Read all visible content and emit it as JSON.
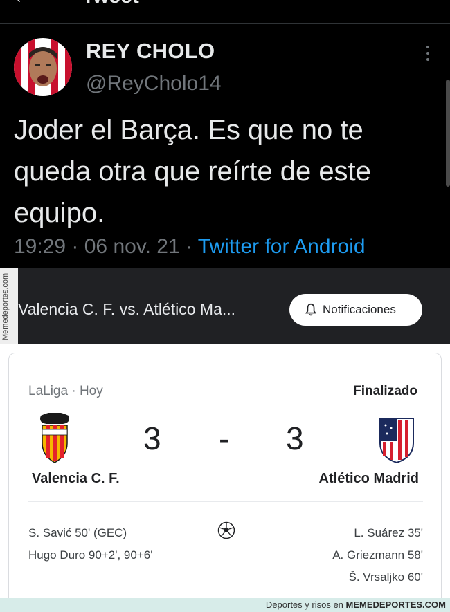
{
  "header": {
    "back_icon": "back-arrow-icon",
    "title": "Tweet"
  },
  "tweet": {
    "display_name": "REY CHOLO",
    "handle": "@ReyCholo14",
    "text": "Joder el Barça. Es que no te queda otra que reírte de este equipo.",
    "time": "19:29",
    "date": "06 nov. 21",
    "source": "Twitter for Android",
    "accent_color": "#1d9bf0"
  },
  "watermark_side": "Memedeportes.com",
  "match_header": {
    "title": "Valencia C. F. vs. Atlético Ma...",
    "notifications_label": "Notificaciones"
  },
  "match": {
    "league": "LaLiga · Hoy",
    "status": "Finalizado",
    "home_team": "Valencia C. F.",
    "away_team": "Atlético Madrid",
    "home_score": "3",
    "separator": "-",
    "away_score": "3",
    "home_goals": [
      "S. Savić 50' (GEC)",
      "Hugo Duro 90+2', 90+6'"
    ],
    "away_goals": [
      "L. Suárez 35'",
      "A. Griezmann 58'",
      "Š. Vrsaljko 60'"
    ],
    "goal_icon": "soccer-ball-icon"
  },
  "watermark_bottom": {
    "text": "Deportes y risos en",
    "brand": "MEMEDEPORTES.COM"
  }
}
